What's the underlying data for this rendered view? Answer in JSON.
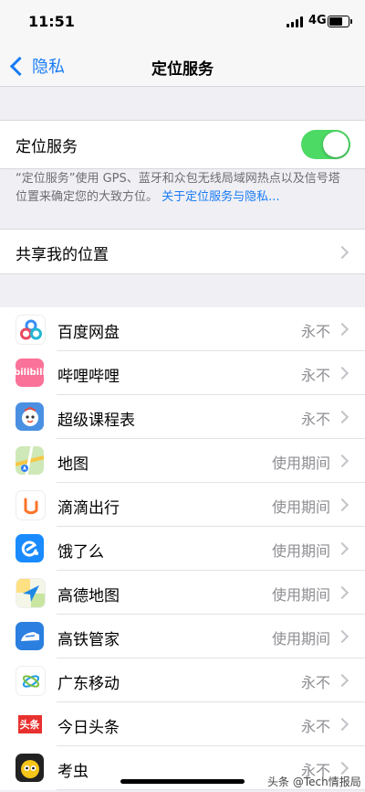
{
  "status_bar": {
    "time": "11:51",
    "network": "4G"
  },
  "nav": {
    "back_label": "隐私",
    "title": "定位服务"
  },
  "location_services": {
    "label": "定位服务",
    "enabled": true,
    "footer_text": "“定位服务”使用 GPS、蓝牙和众包无线局域网热点以及信号塔位置来确定您的大致方位。",
    "footer_link": "关于定位服务与隐私..."
  },
  "share_location": {
    "label": "共享我的位置"
  },
  "apps": [
    {
      "name": "百度网盘",
      "status": "永不",
      "icon": "baidu-netdisk-icon"
    },
    {
      "name": "哔哩哔哩",
      "status": "永不",
      "icon": "bilibili-icon"
    },
    {
      "name": "超级课程表",
      "status": "永不",
      "icon": "super-schedule-icon"
    },
    {
      "name": "地图",
      "status": "使用期间",
      "icon": "maps-icon"
    },
    {
      "name": "滴滴出行",
      "status": "使用期间",
      "icon": "didi-icon"
    },
    {
      "name": "饿了么",
      "status": "使用期间",
      "icon": "eleme-icon"
    },
    {
      "name": "高德地图",
      "status": "使用期间",
      "icon": "amap-icon"
    },
    {
      "name": "高铁管家",
      "status": "使用期间",
      "icon": "gaotie-icon"
    },
    {
      "name": "广东移动",
      "status": "永不",
      "icon": "china-mobile-icon"
    },
    {
      "name": "今日头条",
      "status": "永不",
      "icon": "toutiao-icon"
    },
    {
      "name": "考虫",
      "status": "永不",
      "icon": "kaochong-icon"
    }
  ],
  "icon_text": {
    "bilibili": "bilibili",
    "toutiao": "头条"
  },
  "watermark": "头条 @Tech情报局",
  "colors": {
    "accent": "#1a7cf5",
    "toggle_on": "#4cd964",
    "secondary_text": "#8e8e93"
  }
}
